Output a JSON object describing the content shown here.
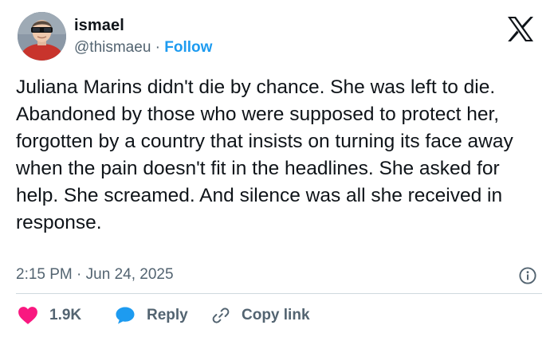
{
  "author": {
    "display_name": "ismael",
    "handle": "@thismaeu",
    "separator": "·",
    "follow_label": "Follow"
  },
  "tweet": {
    "text": "Juliana Marins didn't die by chance. She was left to die. Abandoned by those who were supposed to protect her, forgotten by a country that insists on turning its face away when the pain doesn't fit in the headlines. She asked for help. She screamed. And silence was all she received in response.",
    "time": "2:15 PM",
    "separator": "·",
    "date": "Jun 24, 2025"
  },
  "actions": {
    "like_count": "1.9K",
    "reply_label": "Reply",
    "copy_link_label": "Copy link"
  },
  "icons": {
    "brand": "x-logo-icon",
    "info": "info-icon",
    "like": "heart-icon",
    "reply": "speech-bubble-icon",
    "copy": "link-icon"
  },
  "colors": {
    "accent": "#1d9bf0",
    "like": "#f91880",
    "text": "#0f1419",
    "muted": "#536471"
  }
}
